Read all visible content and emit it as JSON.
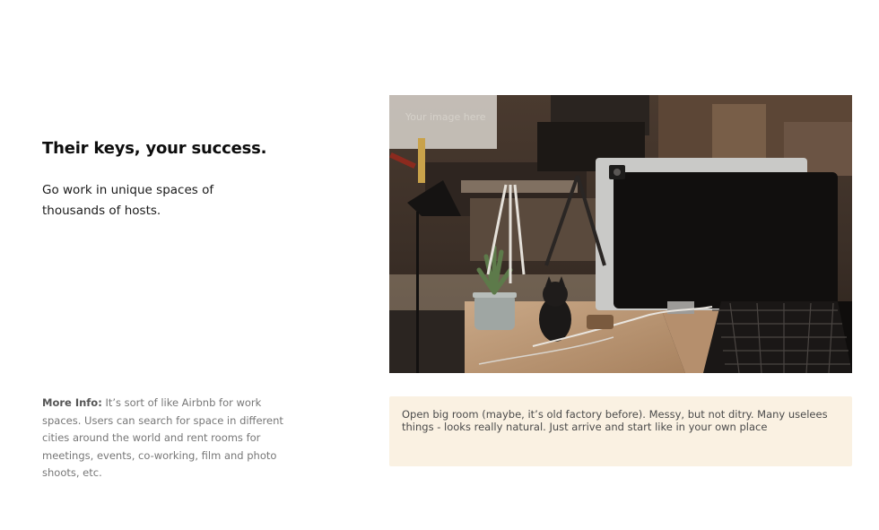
{
  "hero": {
    "headline": "Their keys, your success.",
    "subtext": "Go work in unique spaces of thousands of hosts."
  },
  "more_info": {
    "label": "More Info:",
    "text": " It’s sort of like Airbnb for work spaces. Users can search for space in different cities around the world and rent rooms for meetings, events, co-working, film and photo shoots, etc."
  },
  "image": {
    "placeholder": "Your image here"
  },
  "note": {
    "text": "Open big room (maybe, it’s old factory before). Messy, but not ditry. Many uselees things - looks really natural. Just arrive and start like in your own place"
  },
  "colors": {
    "note_background": "#faf1e2",
    "headline": "#0d0d0d",
    "muted_text": "#777777"
  }
}
